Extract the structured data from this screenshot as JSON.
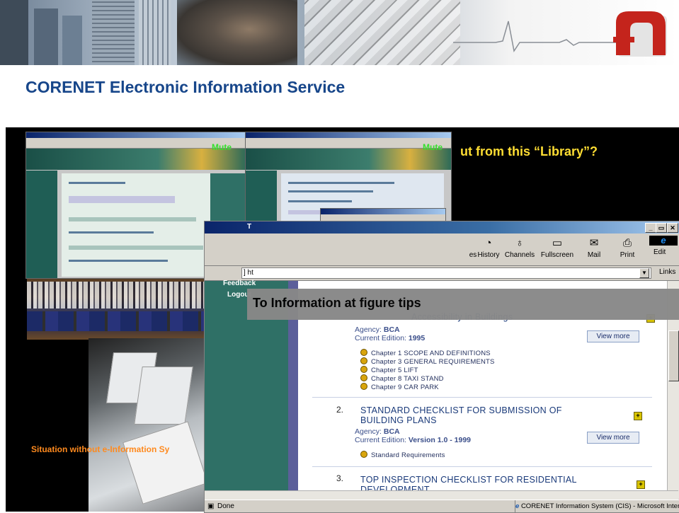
{
  "slide": {
    "title": "CORENET Electronic Information Service",
    "subtitle": "ut from this “Library”?",
    "caption": "Situation without e-Information Sy"
  },
  "screenshots": {
    "mute_left": "Mute",
    "mute_right": "Mute"
  },
  "browser": {
    "title_fragment": "T",
    "toolbar": [
      {
        "label": "es",
        "icon": "search-icon"
      },
      {
        "label": "History",
        "icon": "history-icon"
      },
      {
        "label": "Channels",
        "icon": "channels-icon"
      },
      {
        "label": "Fullscreen",
        "icon": "fullscreen-icon"
      },
      {
        "label": "Mail",
        "icon": "mail-icon"
      },
      {
        "label": "Print",
        "icon": "print-icon"
      },
      {
        "label": "Edit",
        "icon": "edit-icon"
      }
    ],
    "address": "] ht",
    "links": "Links",
    "nav": [
      "Feedback",
      "Logout"
    ],
    "overlay": "To Information at figure tips",
    "status": "Done",
    "taskbar_item": "CORENET Information System (CIS) - Microsoft Internet Ex",
    "entries": {
      "e1": {
        "title_fragment": "Accessibility in Buildings",
        "agency_label": "Agency:",
        "agency": "BCA",
        "edition_label": "Current Edition:",
        "edition": "1995",
        "view_more": "View more",
        "chapters": [
          "Chapter 1 SCOPE AND DEFINITIONS",
          "Chapter 3 GENERAL REQUIREMENTS",
          "Chapter 5 LIFT",
          "Chapter 8 TAXI STAND",
          "Chapter 9 CAR PARK"
        ]
      },
      "e2": {
        "num": "2.",
        "title_line1": "STANDARD CHECKLIST FOR SUBMISSION OF",
        "title_line2": "BUILDING PLANS",
        "agency_label": "Agency:",
        "agency": "BCA",
        "edition_label": "Current Edition:",
        "edition": "Version 1.0 - 1999",
        "view_more": "View more",
        "item": "Standard Requirements"
      },
      "e3": {
        "num": "3.",
        "title_line1": "TOP INSPECTION CHECKLIST FOR RESIDENTIAL",
        "title_line2": "DEVELOPMENT"
      }
    }
  },
  "colors": {
    "title": "#17468a",
    "subtitle": "#ffde33",
    "caption": "#ff8a1e",
    "mute": "#36e02e",
    "nav_bg": "#2f7066"
  }
}
